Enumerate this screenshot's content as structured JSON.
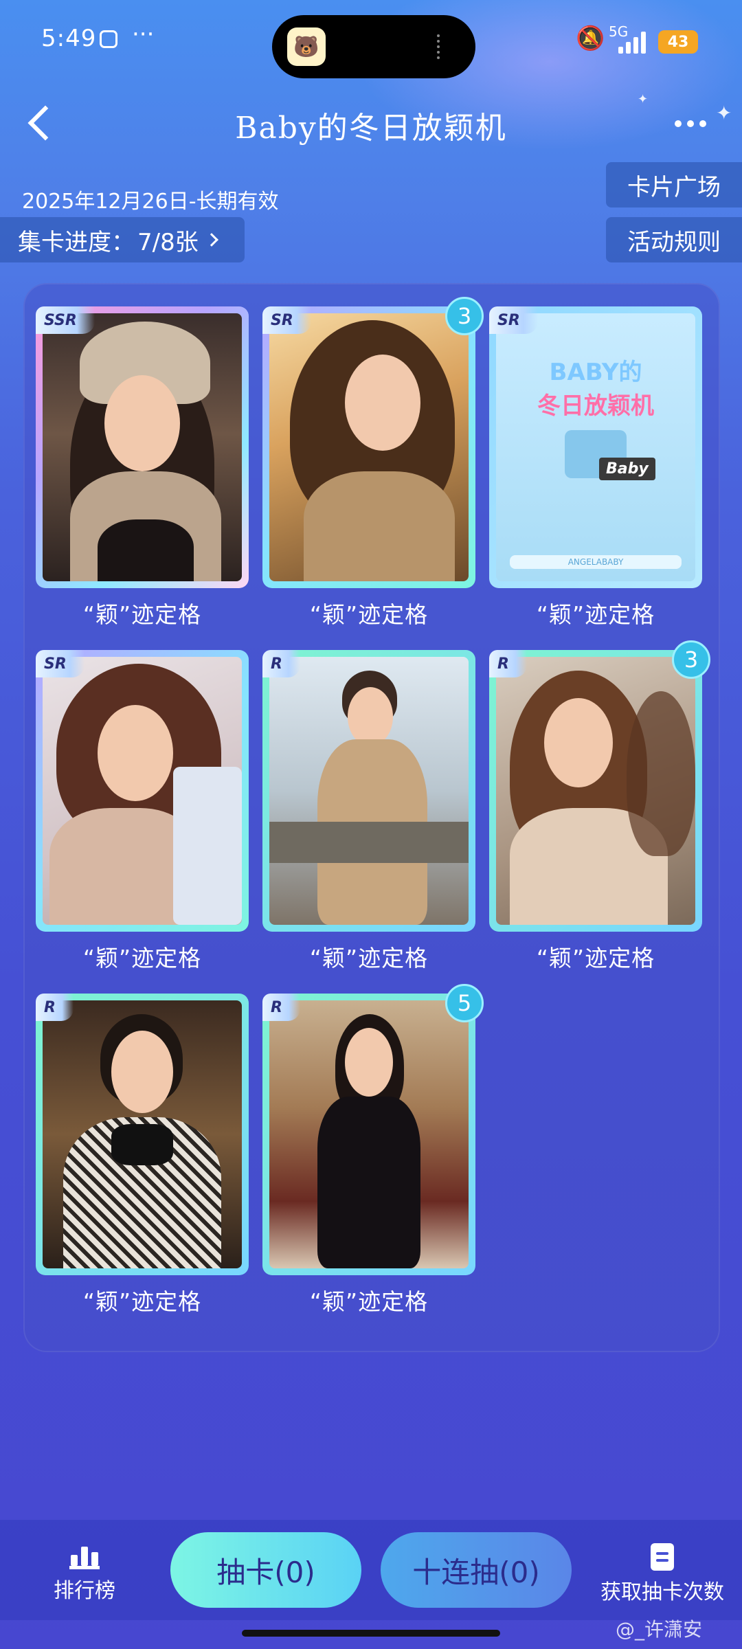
{
  "status_bar": {
    "time": "5:49",
    "dots": "···",
    "network": "5G",
    "battery": "43"
  },
  "header": {
    "title": "Baby的冬日放颖机"
  },
  "info": {
    "date_range": "2025年12月26日-长期有效",
    "progress_label": "集卡进度：",
    "progress_value": "7/8张",
    "card_square_label": "卡片广场",
    "rules_label": "活动规则"
  },
  "cards": [
    {
      "rarity": "SSR",
      "caption": "“颖”迹定格",
      "count": ""
    },
    {
      "rarity": "SR",
      "caption": "“颖”迹定格",
      "count": "3"
    },
    {
      "rarity": "SR",
      "caption": "“颖”迹定格",
      "count": "",
      "poster_title_1": "BABY的",
      "poster_title_2": "冬日放颖机",
      "poster_sign": "Baby",
      "poster_foot": "ANGELABABY"
    },
    {
      "rarity": "SR",
      "caption": "“颖”迹定格",
      "count": ""
    },
    {
      "rarity": "R",
      "caption": "“颖”迹定格",
      "count": ""
    },
    {
      "rarity": "R",
      "caption": "“颖”迹定格",
      "count": "3"
    },
    {
      "rarity": "R",
      "caption": "“颖”迹定格",
      "count": ""
    },
    {
      "rarity": "R",
      "caption": "“颖”迹定格",
      "count": "5"
    }
  ],
  "bottom_bar": {
    "ranking_label": "排行榜",
    "draw_one_label": "抽卡(0)",
    "draw_ten_label": "十连抽(0)",
    "get_draws_label": "获取抽卡次数"
  },
  "watermark": "@_许潇安",
  "icons": [
    "back-chevron-icon",
    "more-dots-icon",
    "ranking-bar-icon",
    "document-icon",
    "bell-muted-icon",
    "signal-icon",
    "battery-icon"
  ],
  "colors": {
    "accent_cyan": "#7df5e4",
    "badge_count": "#36c0e8",
    "button_text": "#2b2c8c"
  }
}
